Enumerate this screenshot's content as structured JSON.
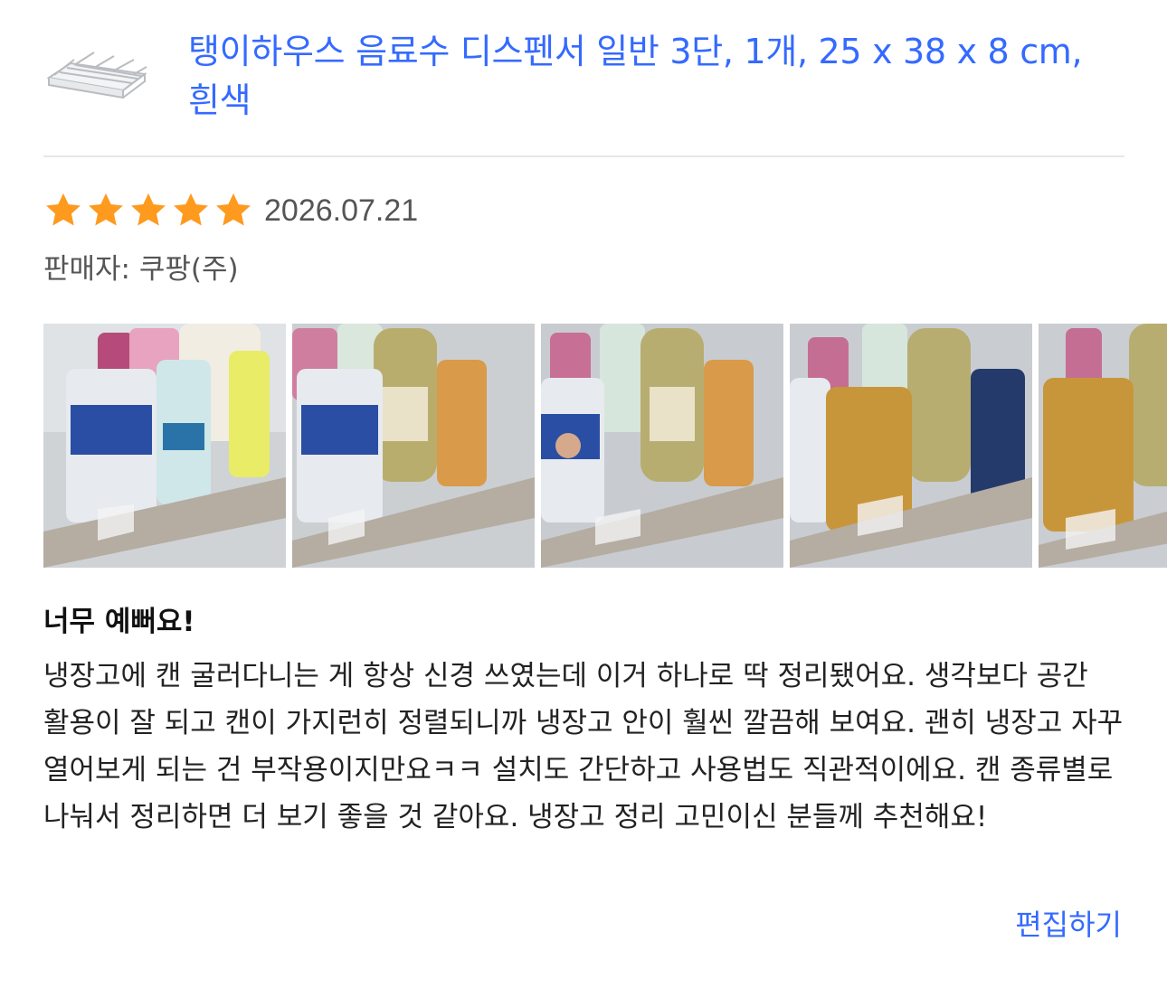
{
  "product": {
    "image_icon": "drink-dispenser-product-thumbnail",
    "title": "탱이하우스 음료수 디스펜서 일반 3단, 1개, 25 x 38 x 8 cm, 흰색"
  },
  "review": {
    "rating": 5,
    "max_rating": 5,
    "star_color": "#fe9a1e",
    "date": "2026.07.21",
    "seller": "판매자: 쿠팡(주)",
    "photos": [
      {
        "icon": "review-photo-fridge-cans"
      },
      {
        "icon": "review-photo-fridge-cans"
      },
      {
        "icon": "review-photo-fridge-cans"
      },
      {
        "icon": "review-photo-fridge-cans"
      },
      {
        "icon": "review-photo-fridge-cans"
      }
    ],
    "headline": "너무 예뻐요!",
    "body": "냉장고에 캔 굴러다니는 게 항상 신경 쓰였는데 이거 하나로 딱 정리됐어요. 생각보다 공간 활용이 잘 되고 캔이 가지런히 정렬되니까 냉장고 안이 훨씬 깔끔해 보여요. 괜히 냉장고 자꾸 열어보게 되는 건 부작용이지만요ㅋㅋ 설치도 간단하고 사용법도 직관적이에요. 캔 종류별로 나눠서 정리하면 더 보기 좋을 것 같아요. 냉장고 정리 고민이신 분들께 추천해요!"
  },
  "actions": {
    "edit_label": "편집하기"
  },
  "colors": {
    "link": "#346aff",
    "divider": "#e6e6e6",
    "meta_text": "#555555"
  }
}
